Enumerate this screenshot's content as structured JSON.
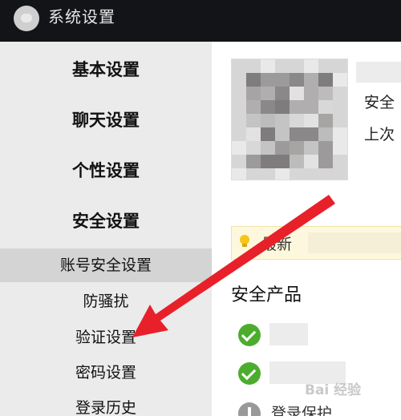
{
  "window": {
    "title": "系统设置"
  },
  "sidebar": {
    "sections": [
      "基本设置",
      "聊天设置",
      "个性设置",
      "安全设置"
    ],
    "items": [
      "账号安全设置",
      "防骚扰",
      "验证设置",
      "密码设置",
      "登录历史"
    ],
    "active_item": "账号安全设置"
  },
  "main": {
    "account": {
      "line1_partial": "安全",
      "line2_partial": "上次"
    },
    "tip": {
      "label_partial": "最新"
    },
    "security_products": {
      "heading": "安全产品",
      "item3_label_partial": "登录保护"
    }
  },
  "colors": {
    "titlebar": "#121418",
    "sidebar": "#ebebeb",
    "active_item": "#d4d4d4",
    "arrow": "#e8202a",
    "check": "#4cad2d",
    "tip_bg": "#fdf8dd"
  },
  "icons": [
    "app-logo-icon",
    "lightbulb-icon",
    "check-icon",
    "info-icon"
  ],
  "watermark": {
    "text": "Bai 经验"
  }
}
